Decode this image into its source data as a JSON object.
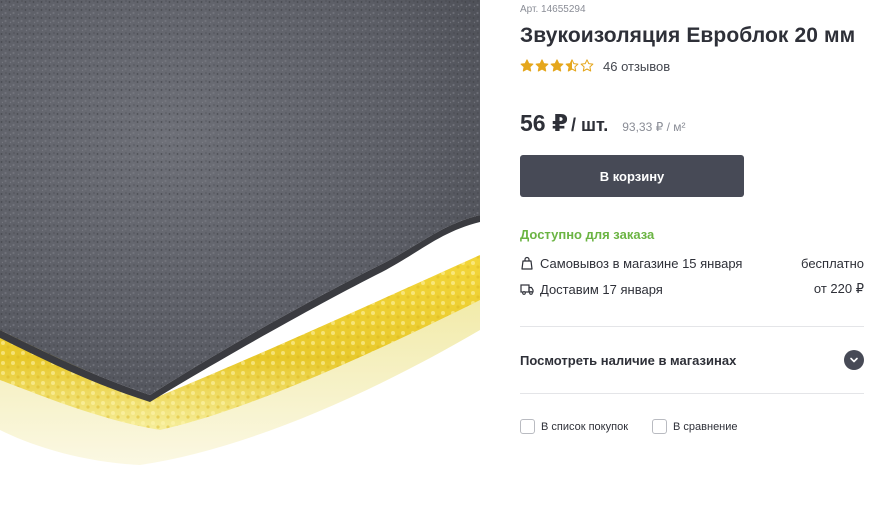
{
  "product": {
    "article": "Арт. 14655294",
    "title": "Звукоизоляция Евроблок 20 мм",
    "image_alt": "product-photo",
    "rating": 3.5,
    "rating_max": 5,
    "reviews": "46 отзывов"
  },
  "price": {
    "main": "56 ₽",
    "unit": "/ шт.",
    "per_square": "93,33 ₽ / м²"
  },
  "cart": {
    "label": "В корзину"
  },
  "availability": {
    "status": "Доступно для заказа",
    "pickup_label": "Самовывоз в магазине 15 января",
    "pickup_cost": "бесплатно",
    "delivery_label": "Доставим 17 января",
    "delivery_cost": "от 220 ₽"
  },
  "stores": {
    "label": "Посмотреть наличие в магазинах"
  },
  "actions": {
    "shopping_list": "В список покупок",
    "compare": "В сравнение"
  },
  "colors": {
    "accent_dark": "#474a56",
    "available_green": "#6bb443",
    "star": "#e5a71d"
  },
  "icons": {
    "pickup": "shopping-bag-icon",
    "delivery": "truck-icon",
    "expand": "chevron-down-icon"
  }
}
